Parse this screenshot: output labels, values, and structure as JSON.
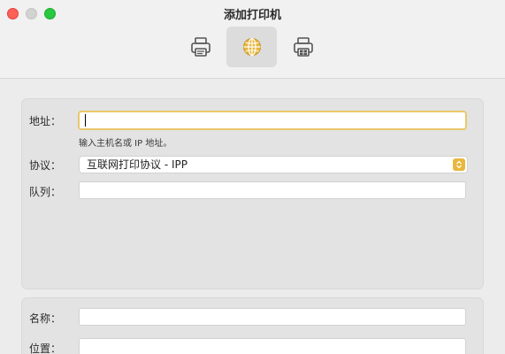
{
  "window": {
    "title": "添加打印机"
  },
  "toolbar": {
    "items": [
      {
        "icon": "printer-icon",
        "selected": false
      },
      {
        "icon": "globe-icon",
        "selected": true
      },
      {
        "icon": "printer-icon",
        "selected": false
      }
    ]
  },
  "form": {
    "address_label": "地址：",
    "address_value": "",
    "address_hint": "输入主机名或 IP 地址。",
    "protocol_label": "协议：",
    "protocol_value": "互联网打印协议 - IPP",
    "queue_label": "队列：",
    "queue_value": "",
    "name_label": "名称：",
    "name_value": "",
    "location_label": "位置：",
    "location_value": ""
  },
  "colors": {
    "accent": "#e9b73d",
    "focus_ring": "#e9c86a",
    "close": "#fe5f57",
    "zoom": "#28c840"
  }
}
